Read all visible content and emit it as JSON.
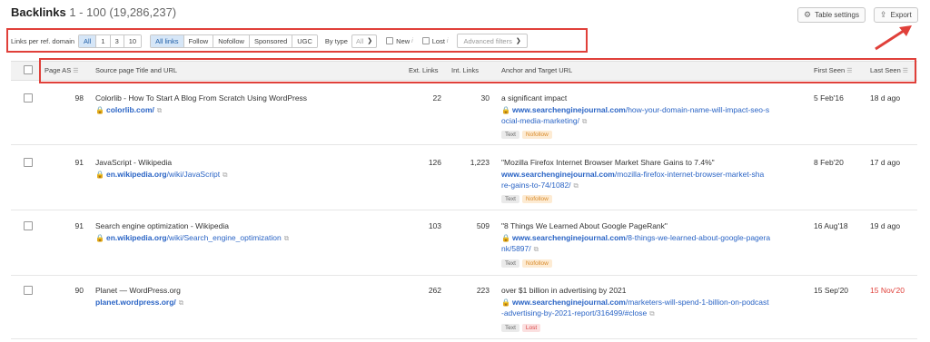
{
  "header": {
    "title": "Backlinks",
    "range": "1 - 100 (19,286,237)",
    "table_settings": "Table settings",
    "export": "Export"
  },
  "filters": {
    "links_per_domain_label": "Links per ref. domain",
    "links_per_domain_options": [
      "All",
      "1",
      "3",
      "10"
    ],
    "link_type_options": [
      "All links",
      "Follow",
      "Nofollow",
      "Sponsored",
      "UGC"
    ],
    "by_type_label": "By type",
    "by_type_value": "All",
    "new_label": "New",
    "lost_label": "Lost",
    "advanced": "Advanced filters"
  },
  "columns": {
    "page_as": "Page AS",
    "source": "Source page Title and URL",
    "ext_links": "Ext. Links",
    "int_links": "Int. Links",
    "anchor": "Anchor and Target URL",
    "first_seen": "First Seen",
    "last_seen": "Last Seen"
  },
  "rows": [
    {
      "as": "98",
      "title": "Colorlib - How To Start A Blog From Scratch Using WordPress",
      "domain": "colorlib.com/",
      "path": "",
      "ext": "22",
      "int": "30",
      "anchor": "a significant impact",
      "target_domain": "www.searchenginejournal.com",
      "target_path_1": "/how-your-domain-name-will-impact-seo-s",
      "target_path_2": "ocial-media-marketing/",
      "tag1": "Text",
      "tag2": "Nofollow",
      "first": "5 Feb'16",
      "last": "18 d ago"
    },
    {
      "as": "91",
      "title": "JavaScript - Wikipedia",
      "domain": "en.wikipedia.org",
      "path": "/wiki/JavaScript",
      "ext": "126",
      "int": "1,223",
      "anchor": "\"Mozilla Firefox Internet Browser Market Share Gains to 7.4%\"",
      "target_domain": "www.searchenginejournal.com",
      "target_path_1": "/mozilla-firefox-internet-browser-market-sha",
      "target_path_2": "re-gains-to-74/1082/",
      "tag1": "Text",
      "tag2": "Nofollow",
      "first": "8 Feb'20",
      "last": "17 d ago"
    },
    {
      "as": "91",
      "title": "Search engine optimization - Wikipedia",
      "domain": "en.wikipedia.org",
      "path": "/wiki/Search_engine_optimization",
      "ext": "103",
      "int": "509",
      "anchor": "\"8 Things We Learned About Google PageRank\"",
      "target_domain": "www.searchenginejournal.com",
      "target_path_1": "/8-things-we-learned-about-google-pagera",
      "target_path_2": "nk/5897/",
      "tag1": "Text",
      "tag2": "Nofollow",
      "first": "16 Aug'18",
      "last": "19 d ago"
    },
    {
      "as": "90",
      "title": "Planet — WordPress.org",
      "domain": "planet.wordpress.org/",
      "path": "",
      "ext": "262",
      "int": "223",
      "anchor": "over $1 billion in advertising by 2021",
      "target_domain": "www.searchenginejournal.com",
      "target_path_1": "/marketers-will-spend-1-billion-on-podcast",
      "target_path_2": "-advertising-by-2021-report/316499/#close",
      "tag1": "Text",
      "tag2": "Lost",
      "first": "15 Sep'20",
      "last": "15 Nov'20"
    }
  ],
  "colors": {
    "accent": "#2a64c5",
    "highlight_box": "#e0403a",
    "lost": "#e0403a"
  }
}
